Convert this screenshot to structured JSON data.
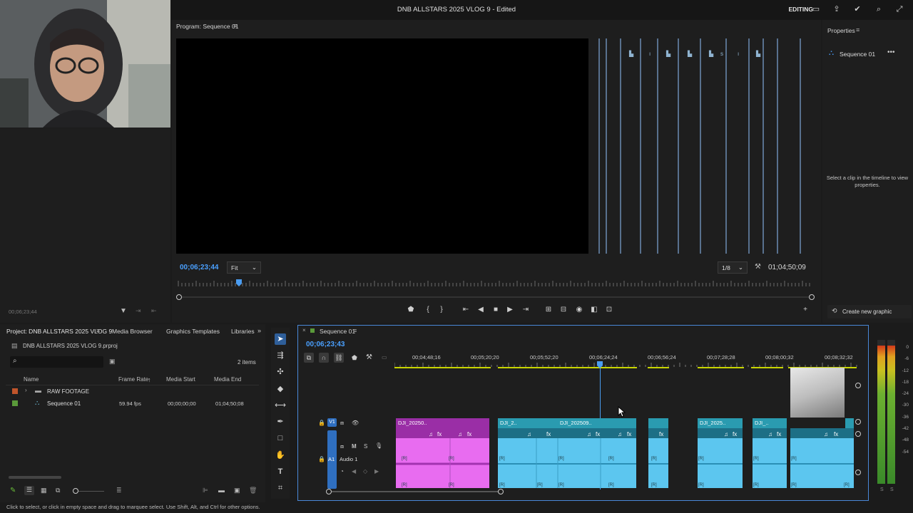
{
  "app": {
    "title": "DNB ALLSTARS 2025 VLOG 9 - Edited",
    "workspace": "EDITING"
  },
  "program": {
    "title": "Program: Sequence 01",
    "timecode_current": "00;06;23;44",
    "fit": "Fit",
    "resolution": "1/8",
    "timecode_duration": "01;04;50;09"
  },
  "properties": {
    "title": "Properties",
    "sequence_name": "Sequence 01",
    "empty_message": "Select a clip in the timeline to view properties.",
    "create_graphic": "Create new graphic"
  },
  "left_panel": {
    "timecode": "00;06;23;44"
  },
  "project": {
    "tabs": [
      "Project: DNB ALLSTARS 2025 VLOG 9",
      "Media Browser",
      "Graphics Templates",
      "Libraries"
    ],
    "file": "DNB ALLSTARS 2025 VLOG 9.prproj",
    "item_count": "2 items",
    "columns": [
      "Name",
      "Frame Rate",
      "Media Start",
      "Media End"
    ],
    "rows": [
      {
        "name": "RAW FOOTAGE",
        "frame_rate": "",
        "media_start": "",
        "media_end": "",
        "color": "#c0552b"
      },
      {
        "name": "Sequence 01",
        "frame_rate": "59.94 fps",
        "media_start": "00;00;00;00",
        "media_end": "01;04;50;08",
        "color": "#5a9a3a"
      }
    ]
  },
  "timeline": {
    "tab": "Sequence 01",
    "timecode": "00;06;23;43",
    "ticks": [
      "00;04;48;16",
      "00;05;20;20",
      "00;05;52;20",
      "00;06;24;24",
      "00;06;56;24",
      "00;07;28;28",
      "00;08;00;32",
      "00;08;32;32"
    ],
    "video_track": "V1",
    "audio_track": "A1",
    "audio_track_name": "Audio 1",
    "clip_labels": [
      "DJI_20250..",
      "DJI_2..",
      "DJI_202509..",
      "DJI_2025..",
      "DJI_.."
    ]
  },
  "meter": {
    "scale": [
      "0",
      "-6",
      "-12",
      "-18",
      "-24",
      "-30",
      "-36",
      "-42",
      "-48",
      "-54"
    ],
    "labels": [
      "S",
      "S"
    ]
  },
  "status": "Click to select, or click in empty space and drag to marquee select. Use Shift, Alt, and Ctrl for other options.",
  "colors": {
    "accent": "#4aa0ff",
    "pink_clip": "#e86cf0",
    "blue_clip": "#5cc6ef",
    "teal_clip": "#2a9bb0",
    "purple_clip": "#9a2ea6"
  }
}
